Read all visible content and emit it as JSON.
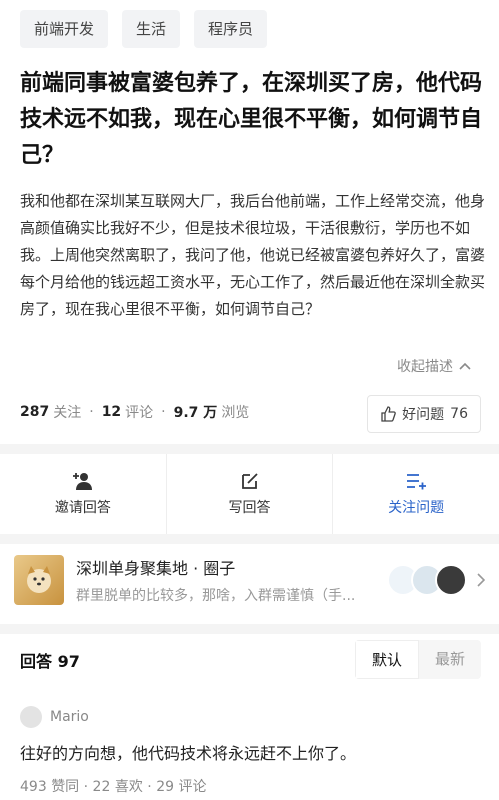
{
  "tags": [
    "前端开发",
    "生活",
    "程序员"
  ],
  "question": {
    "title": "前端同事被富婆包养了，在深圳买了房，他代码技术远不如我，现在心里很不平衡，如何调节自己？",
    "description": "我和他都在深圳某互联网大厂，我后台他前端，工作上经常交流，他身高颜值确实比我好不少，但是技术很垃圾，干活很敷衍，学历也不如我。上周他突然离职了，我问了他，他说已经被富婆包养好久了，富婆每个月给他的钱远超工资水平，无心工作了，然后最近他在深圳全款买房了，现在我心里很不平衡，如何调节自己？",
    "collapse_label": "收起描述"
  },
  "stats": {
    "follow_count": "287",
    "follow_label": "关注",
    "comment_count": "12",
    "comment_label": "评论",
    "view_count": "9.7 万",
    "view_label": "浏览",
    "good_label": "好问题",
    "good_count": "76"
  },
  "actions": [
    {
      "label": "邀请回答",
      "icon": "invite-icon"
    },
    {
      "label": "写回答",
      "icon": "edit-icon"
    },
    {
      "label": "关注问题",
      "icon": "follow-icon"
    }
  ],
  "circle": {
    "title": "深圳单身聚集地 · 圈子",
    "subtitle": "群里脱单的比较多，那啥，入群需谨慎（手..."
  },
  "answers": {
    "label": "回答",
    "count": "97",
    "sort_default": "默认",
    "sort_latest": "最新"
  },
  "answer": {
    "user": "Mario",
    "text": "往好的方向想，他代码技术将永远赶不上你了。",
    "likes": "493",
    "likes_label": "赞同",
    "favorites": "22",
    "favorites_label": "喜欢",
    "comments": "29",
    "comments_label": "评论"
  },
  "colors": {
    "accent": "#2a63c9",
    "muted": "#8a8a8a"
  }
}
